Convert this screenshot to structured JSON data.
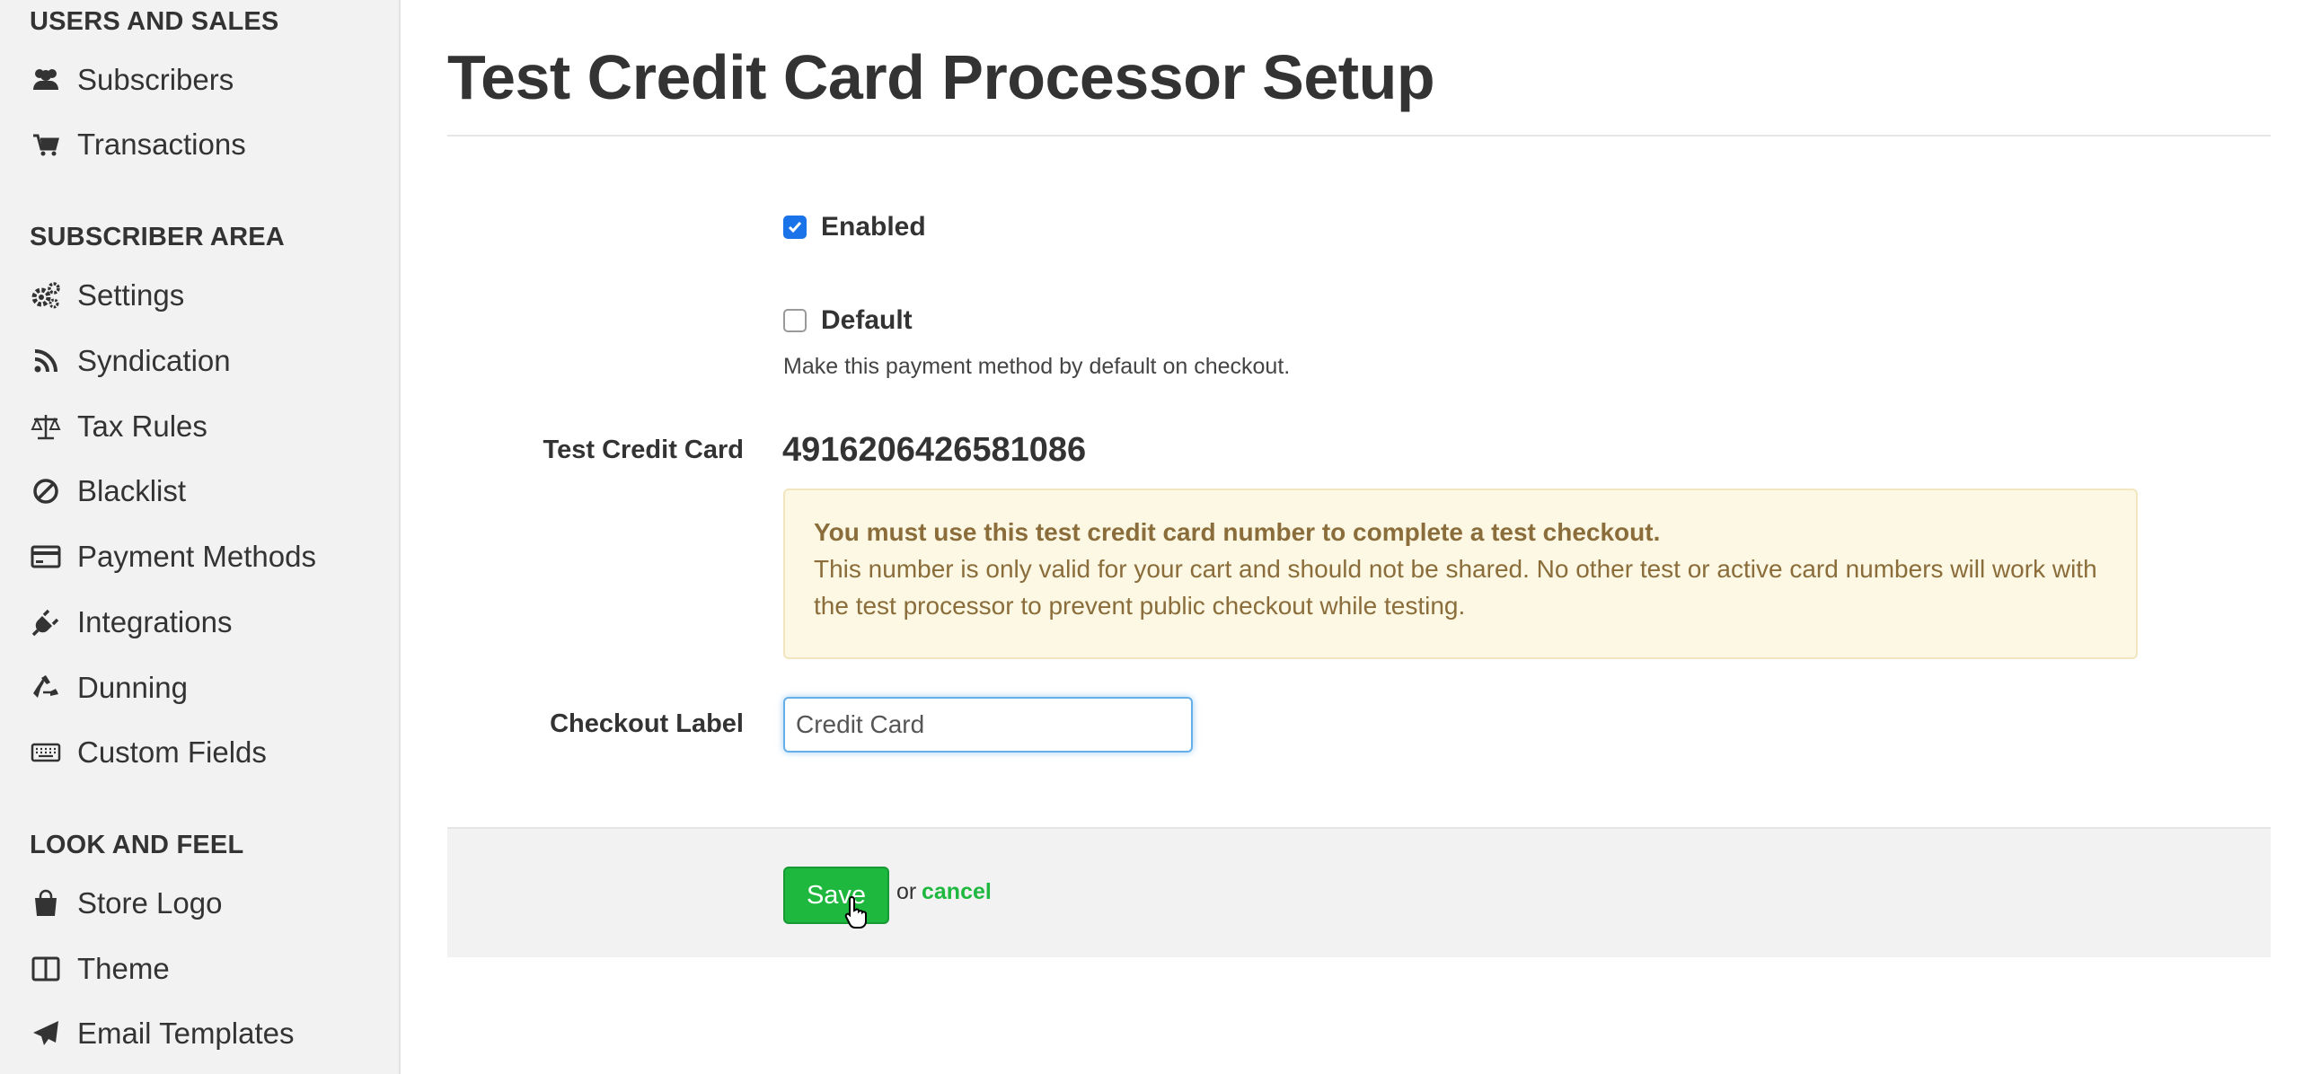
{
  "sidebar": {
    "sections": [
      {
        "title": "USERS AND SALES",
        "items": [
          {
            "label": "Subscribers",
            "icon": "users-icon"
          },
          {
            "label": "Transactions",
            "icon": "cart-icon"
          }
        ]
      },
      {
        "title": "SUBSCRIBER AREA",
        "items": [
          {
            "label": "Settings",
            "icon": "gears-icon"
          },
          {
            "label": "Syndication",
            "icon": "rss-icon"
          },
          {
            "label": "Tax Rules",
            "icon": "scale-icon"
          },
          {
            "label": "Blacklist",
            "icon": "ban-icon"
          },
          {
            "label": "Payment Methods",
            "icon": "credit-card-icon"
          },
          {
            "label": "Integrations",
            "icon": "plug-icon"
          },
          {
            "label": "Dunning",
            "icon": "recycle-icon"
          },
          {
            "label": "Custom Fields",
            "icon": "keyboard-icon"
          }
        ]
      },
      {
        "title": "LOOK AND FEEL",
        "items": [
          {
            "label": "Store Logo",
            "icon": "shopping-bag-icon"
          },
          {
            "label": "Theme",
            "icon": "columns-icon"
          },
          {
            "label": "Email Templates",
            "icon": "paper-plane-icon"
          }
        ]
      }
    ]
  },
  "main": {
    "title": "Test Credit Card Processor Setup",
    "enabled": {
      "label": "Enabled",
      "checked": true
    },
    "default": {
      "label": "Default",
      "checked": false,
      "help": "Make this payment method by default on checkout."
    },
    "test_card": {
      "label": "Test Credit Card",
      "number": "4916206426581086",
      "alert_strong": "You must use this test credit card number to complete a test checkout.",
      "alert_body": "This number is only valid for your cart and should not be shared. No other test or active card numbers will work with the test processor to prevent public checkout while testing."
    },
    "checkout_label": {
      "label": "Checkout Label",
      "value": "Credit Card"
    },
    "actions": {
      "save": "Save",
      "or": "or",
      "cancel": "cancel"
    }
  },
  "colors": {
    "accent_green": "#1fb83f",
    "checkbox_blue": "#1a73e8",
    "alert_bg": "#fcf8e3",
    "alert_text": "#8a6d3b"
  }
}
